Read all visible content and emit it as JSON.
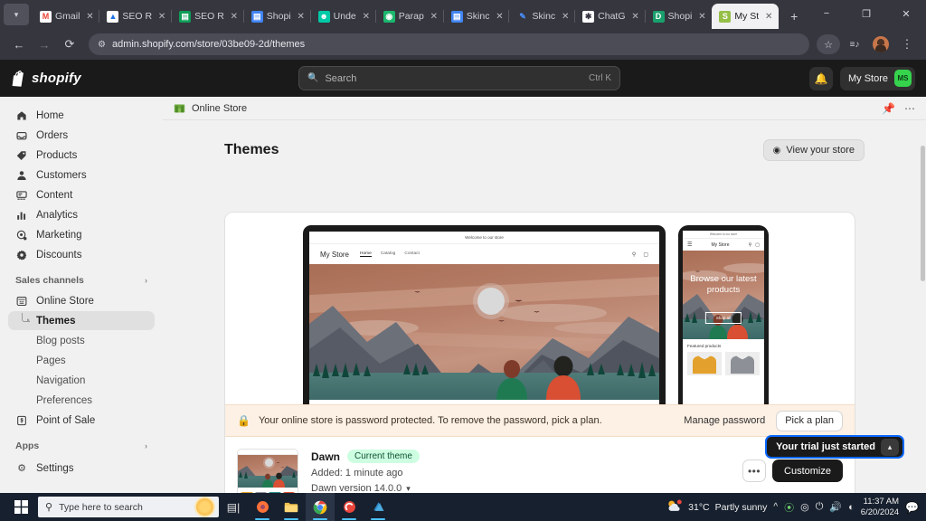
{
  "browser": {
    "tab_list_icon": "chevron-down-icon",
    "new_tab_label": "+",
    "tabs": [
      {
        "title": "Gmail",
        "favicon": "gmail-icon",
        "fav_bg": "#ffffff",
        "fav_fg": "#ea4335",
        "fav_char": "M",
        "active": false
      },
      {
        "title": "SEO R",
        "favicon": "drive-icon",
        "fav_bg": "#ffffff",
        "fav_fg": "#1a73e8",
        "fav_char": "▲",
        "active": false
      },
      {
        "title": "SEO R",
        "favicon": "sheets-icon",
        "fav_bg": "#0f9d58",
        "fav_fg": "#ffffff",
        "fav_char": "▤",
        "active": false
      },
      {
        "title": "Shopi",
        "favicon": "docs-icon",
        "fav_bg": "#4285f4",
        "fav_fg": "#ffffff",
        "fav_char": "▤",
        "active": false
      },
      {
        "title": "Unde",
        "favicon": "chat-bot-icon",
        "fav_bg": "#00c9a7",
        "fav_fg": "#ffffff",
        "fav_char": "☻",
        "active": false
      },
      {
        "title": "Parap",
        "favicon": "bot-icon",
        "fav_bg": "#1bb76e",
        "fav_fg": "#ffffff",
        "fav_char": "◉",
        "active": false
      },
      {
        "title": "Skinc",
        "favicon": "docs-icon",
        "fav_bg": "#4285f4",
        "fav_fg": "#ffffff",
        "fav_char": "▤",
        "active": false
      },
      {
        "title": "Skinc",
        "favicon": "pen-icon",
        "fav_bg": "#35363e",
        "fav_fg": "#4a90ff",
        "fav_char": "✎",
        "active": false
      },
      {
        "title": "ChatG",
        "favicon": "openai-icon",
        "fav_bg": "#ffffff",
        "fav_fg": "#343541",
        "fav_char": "✱",
        "active": false
      },
      {
        "title": "Shopi",
        "favicon": "shopify-doc-icon",
        "fav_bg": "#1aa06d",
        "fav_fg": "#ffffff",
        "fav_char": "D",
        "active": false
      },
      {
        "title": "My St",
        "favicon": "shopify-icon",
        "fav_bg": "#95bf47",
        "fav_fg": "#ffffff",
        "fav_char": "S",
        "active": true
      }
    ],
    "window_controls": {
      "minimize": "−",
      "maximize": "❐",
      "close": "✕"
    },
    "nav": {
      "back": "←",
      "forward": "→",
      "reload": "⟳"
    },
    "omnibox": {
      "site_icon": "site-settings-icon",
      "url": "admin.shopify.com/store/03be09-2d/themes"
    },
    "toolbar_right": {
      "bookmark": "☆",
      "reading_list": "≡♪",
      "profile": "profile-avatar",
      "menu": "⋮"
    }
  },
  "shopify_topbar": {
    "brand": "shopify",
    "search": {
      "placeholder": "Search",
      "shortcut": "Ctrl K",
      "icon": "search-icon"
    },
    "notifications_icon": "bell-icon",
    "store_name": "My Store",
    "store_initials": "MS"
  },
  "sidebar": {
    "items": [
      {
        "label": "Home",
        "icon": "home-icon"
      },
      {
        "label": "Orders",
        "icon": "orders-icon"
      },
      {
        "label": "Products",
        "icon": "tag-icon"
      },
      {
        "label": "Customers",
        "icon": "person-icon"
      },
      {
        "label": "Content",
        "icon": "content-icon"
      },
      {
        "label": "Analytics",
        "icon": "bar-chart-icon"
      },
      {
        "label": "Marketing",
        "icon": "megaphone-icon"
      },
      {
        "label": "Discounts",
        "icon": "discount-icon"
      }
    ],
    "sales_channels": {
      "label": "Sales channels",
      "chevron": "chevron-right-icon",
      "online_store": {
        "label": "Online Store",
        "icon": "storefront-icon"
      },
      "sub_items": [
        {
          "label": "Themes",
          "active": true
        },
        {
          "label": "Blog posts",
          "active": false
        },
        {
          "label": "Pages",
          "active": false
        },
        {
          "label": "Navigation",
          "active": false
        },
        {
          "label": "Preferences",
          "active": false
        }
      ],
      "point_of_sale": {
        "label": "Point of Sale",
        "icon": "pos-icon"
      }
    },
    "apps": {
      "label": "Apps",
      "chevron": "chevron-right-icon"
    },
    "settings": {
      "label": "Settings",
      "icon": "gear-icon"
    }
  },
  "main": {
    "breadcrumb": {
      "label": "Online Store",
      "icon": "storefront-icon"
    },
    "breadcrumb_actions": {
      "pin": "pin-icon",
      "more": "more-horizontal-icon"
    },
    "page_title": "Themes",
    "view_store_button": {
      "label": "View your store",
      "icon": "view-icon"
    },
    "preview": {
      "desktop": {
        "announcement": "Welcome to our store",
        "logo": "My Store",
        "links": [
          "Home",
          "Catalog",
          "Contact"
        ],
        "icons": [
          "search-icon",
          "cart-icon"
        ]
      },
      "mobile": {
        "announcement": "Welcome to our store",
        "menu_icon": "hamburger-icon",
        "logo": "My Store",
        "icons": [
          "search-icon",
          "cart-icon"
        ],
        "hero_heading": "Browse our latest products",
        "hero_button": "Shop all",
        "featured_title": "Featured products"
      }
    },
    "password_banner": {
      "icon": "lock-icon",
      "message": "Your online store is password protected. To remove the password, pick a plan.",
      "manage_link": "Manage password",
      "pick_plan_button": "Pick a plan"
    },
    "theme": {
      "name": "Dawn",
      "badge": "Current theme",
      "added": "Added: 1 minute ago",
      "version": "Dawn version 14.0.0",
      "version_chevron": "chevron-down-icon",
      "more_button": "•••",
      "customize_button": "Customize"
    },
    "trial_toast": {
      "label": "Your trial just started",
      "caret": "collapse-caret-icon"
    }
  },
  "taskbar": {
    "start_icon": "windows-start-icon",
    "search_placeholder": "Type here to search",
    "search_icon": "search-icon",
    "items": [
      {
        "name": "task-view-icon"
      },
      {
        "name": "firefox-icon"
      },
      {
        "name": "file-explorer-icon"
      },
      {
        "name": "chrome-icon"
      },
      {
        "name": "ccleaner-icon"
      },
      {
        "name": "store-icon"
      }
    ],
    "tray": {
      "weather_icon": "partly-sunny-icon",
      "temperature": "31°C",
      "condition": "Partly sunny",
      "chevron": "show-hidden-icons-icon",
      "icons": [
        "update-icon",
        "webcam-icon",
        "battery-icon",
        "volume-icon",
        "wifi-icon"
      ],
      "time": "11:37 AM",
      "date": "6/20/2024",
      "notification_icon": "notification-center-icon"
    }
  },
  "colors": {
    "shopify_green": "#95bf47",
    "accent_green": "#36d34d",
    "badge_green": "#cdfee1",
    "banner_bg": "#fdf0e4",
    "toast_border": "#0a68ff"
  }
}
